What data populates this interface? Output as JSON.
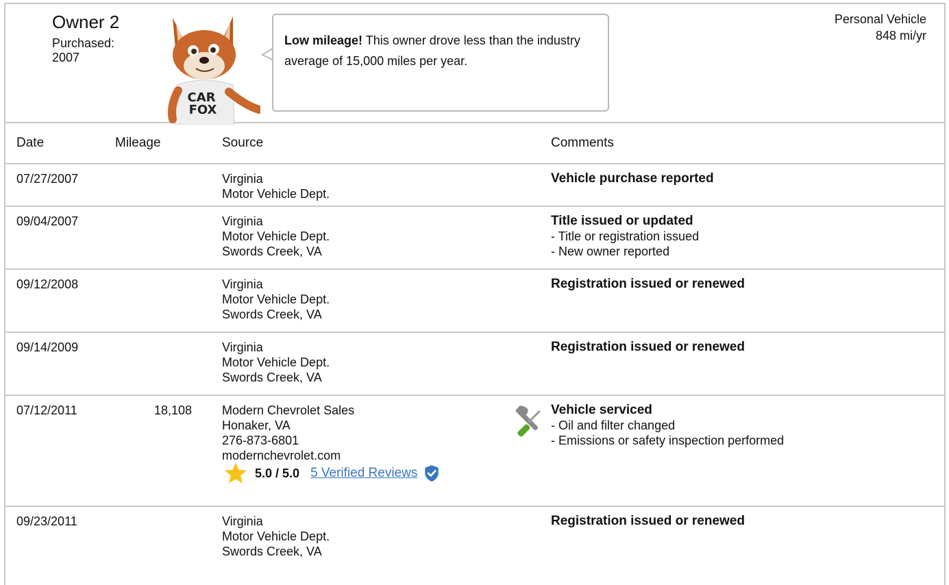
{
  "owner": {
    "title": "Owner 2",
    "purchased_label": "Purchased:",
    "purchased_year": "2007",
    "usage_type": "Personal Vehicle",
    "usage_rate": "848 mi/yr"
  },
  "bubble": {
    "bold": "Low mileage!",
    "text": " This owner drove less than the industry average of 15,000 miles per year."
  },
  "mascot": {
    "shirt_line1": "CAR",
    "shirt_line2": "FOX"
  },
  "columns": {
    "date": "Date",
    "mileage": "Mileage",
    "source": "Source",
    "comments": "Comments"
  },
  "records": [
    {
      "date": "07/27/2007",
      "mileage": "",
      "source": [
        "Virginia",
        "Motor Vehicle Dept."
      ],
      "comment_title": "Vehicle purchase reported",
      "comment_lines": []
    },
    {
      "date": "09/04/2007",
      "mileage": "",
      "source": [
        "Virginia",
        "Motor Vehicle Dept.",
        "Swords Creek, VA"
      ],
      "comment_title": "Title issued or updated",
      "comment_lines": [
        "- Title or registration issued",
        "- New owner reported"
      ]
    },
    {
      "date": "09/12/2008",
      "mileage": "",
      "source": [
        "Virginia",
        "Motor Vehicle Dept.",
        "Swords Creek, VA"
      ],
      "comment_title": "Registration issued or renewed",
      "comment_lines": []
    },
    {
      "date": "09/14/2009",
      "mileage": "",
      "source": [
        "Virginia",
        "Motor Vehicle Dept.",
        "Swords Creek, VA"
      ],
      "comment_title": "Registration issued or renewed",
      "comment_lines": []
    },
    {
      "date": "07/12/2011",
      "mileage": "18,108",
      "source": [
        "Modern Chevrolet Sales",
        "Honaker, VA",
        "276-873-6801",
        "modernchevrolet.com"
      ],
      "comment_title": "Vehicle serviced",
      "comment_lines": [
        "- Oil and filter changed",
        "- Emissions or safety inspection performed"
      ],
      "icon": "service-wrench-screwdriver-icon",
      "rating": {
        "score": "5.0 / 5.0",
        "reviews_link": "5 Verified Reviews"
      }
    },
    {
      "date": "09/23/2011",
      "mileage": "",
      "source": [
        "Virginia",
        "Motor Vehicle Dept.",
        "Swords Creek, VA"
      ],
      "comment_title": "Registration issued or renewed",
      "comment_lines": []
    }
  ],
  "colors": {
    "link": "#3777bc",
    "star": "#f7c31a",
    "shield": "#3777bc",
    "border": "#c8c8c8"
  }
}
